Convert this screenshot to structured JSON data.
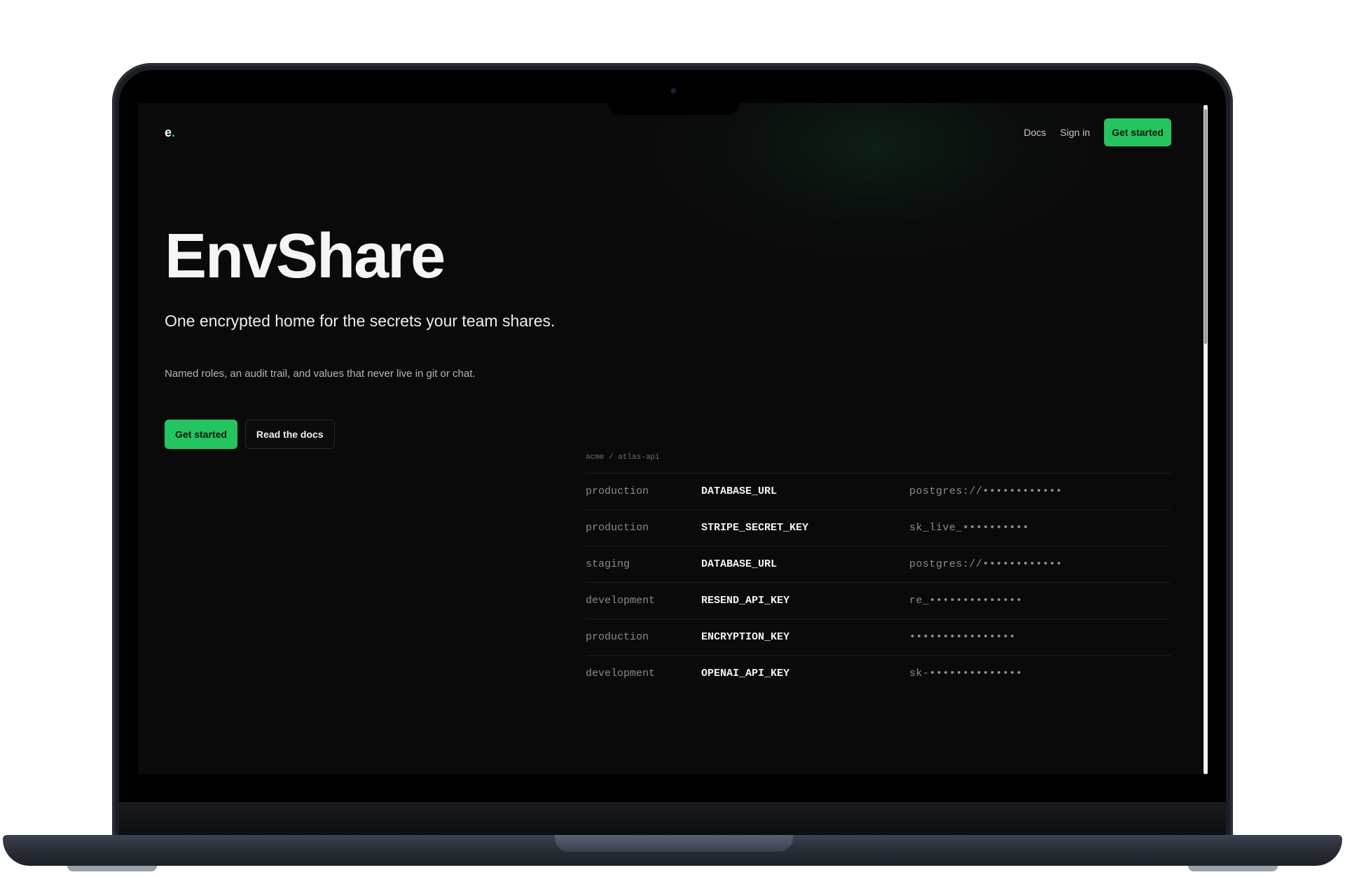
{
  "header": {
    "logo_letter": "e",
    "logo_dot": ".",
    "nav": {
      "docs_label": "Docs",
      "signin_label": "Sign in",
      "cta_label": "Get started"
    }
  },
  "hero": {
    "title": "EnvShare",
    "subtitle": "One encrypted home for the secrets your team shares.",
    "body": "Named roles, an audit trail, and values that never live in git or chat.",
    "primary_label": "Get started",
    "secondary_label": "Read the docs"
  },
  "secrets": {
    "breadcrumb": "acme / atlas-api",
    "rows": [
      {
        "env": "production",
        "key": "DATABASE_URL",
        "value": "postgres://••••••••••••"
      },
      {
        "env": "production",
        "key": "STRIPE_SECRET_KEY",
        "value": "sk_live_••••••••••"
      },
      {
        "env": "staging",
        "key": "DATABASE_URL",
        "value": "postgres://••••••••••••"
      },
      {
        "env": "development",
        "key": "RESEND_API_KEY",
        "value": "re_••••••••••••••"
      },
      {
        "env": "production",
        "key": "ENCRYPTION_KEY",
        "value": "••••••••••••••••"
      },
      {
        "env": "development",
        "key": "OPENAI_API_KEY",
        "value": "sk-••••••••••••••"
      }
    ]
  },
  "colors": {
    "accent": "#22c55e",
    "background": "#0a0a0a",
    "text": "#f5f5f5"
  }
}
